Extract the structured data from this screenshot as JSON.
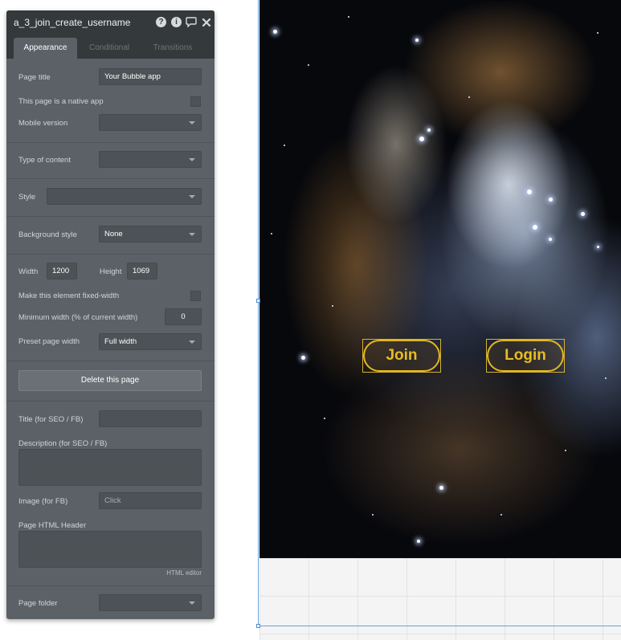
{
  "panel": {
    "title": "a_3_join_create_username",
    "header_icons": [
      "help-icon",
      "info-icon",
      "comment-icon",
      "close-icon"
    ],
    "tabs": [
      {
        "label": "Appearance",
        "active": true
      },
      {
        "label": "Conditional",
        "active": false
      },
      {
        "label": "Transitions",
        "active": false
      }
    ],
    "page_title": {
      "label": "Page title",
      "value": "Your Bubble app"
    },
    "native_app": {
      "label": "This page is a native app",
      "checked": false
    },
    "mobile_version": {
      "label": "Mobile version",
      "value": ""
    },
    "type_of_content": {
      "label": "Type of content",
      "value": ""
    },
    "style": {
      "label": "Style",
      "value": ""
    },
    "background_style": {
      "label": "Background style",
      "value": "None"
    },
    "width": {
      "label": "Width",
      "value": "1200"
    },
    "height": {
      "label": "Height",
      "value": "1069"
    },
    "fixed_width": {
      "label": "Make this element fixed-width",
      "checked": false
    },
    "min_width": {
      "label": "Minimum width (% of current width)",
      "value": "0"
    },
    "preset_width": {
      "label": "Preset page width",
      "value": "Full width"
    },
    "delete_button": "Delete this page",
    "seo_title": {
      "label": "Title (for SEO / FB)",
      "value": ""
    },
    "seo_description": {
      "label": "Description (for SEO / FB)",
      "value": ""
    },
    "fb_image": {
      "label": "Image (for FB)",
      "placeholder": "Click"
    },
    "html_header": {
      "label": "Page HTML Header",
      "value": ""
    },
    "html_editor_link": "HTML editor",
    "page_folder": {
      "label": "Page folder",
      "value": ""
    }
  },
  "canvas": {
    "join_button": "Join",
    "login_button": "Login"
  },
  "colors": {
    "panel_bg": "#5b6166",
    "panel_header": "#34393c",
    "button_accent": "#e4b81e",
    "selection_blue": "#6aa2d8"
  }
}
